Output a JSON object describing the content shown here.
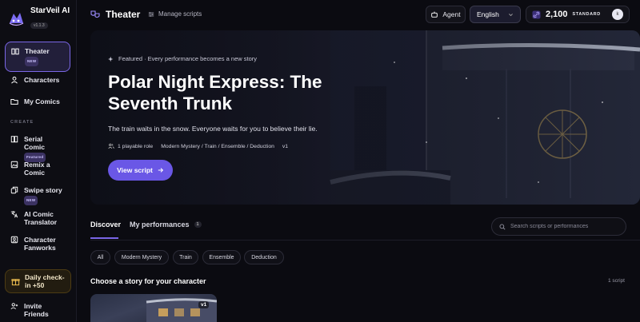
{
  "app": {
    "name": "StarVeil AI",
    "version": "v1.1.3"
  },
  "sidebar": {
    "items": [
      {
        "label": "Theater",
        "badge": "NEW",
        "icon": "book-open-icon"
      },
      {
        "label": "Characters",
        "icon": "user-icon"
      },
      {
        "label": "My Comics",
        "icon": "folder-icon"
      }
    ],
    "create_label": "CREATE",
    "create_items": [
      {
        "label": "Serial Comic",
        "badge": "Featured",
        "icon": "book-icon"
      },
      {
        "label": "Remix a Comic",
        "icon": "image-icon"
      },
      {
        "label": "Swipe story",
        "badge": "NEW",
        "icon": "cards-icon"
      },
      {
        "label": "AI Comic Translator",
        "icon": "translate-icon"
      },
      {
        "label": "Character Fanworks",
        "icon": "portrait-icon"
      }
    ],
    "checkin": "Daily check-in +50",
    "invite": "Invite Friends"
  },
  "header": {
    "title": "Theater",
    "manage": "Manage scripts",
    "agent": "Agent",
    "language": "English",
    "credits": "2,100",
    "plan": "STANDARD",
    "avatar_initial": "k"
  },
  "hero": {
    "featured": "Featured · Every performance becomes a new story",
    "title": "Polar Night Express: The Seventh Trunk",
    "description": "The train waits in the snow. Everyone waits for you to believe their lie.",
    "role": "1 playable role",
    "tags": "Modern Mystery / Train / Ensemble / Deduction",
    "version": "v1",
    "cta": "View script"
  },
  "tabs": {
    "discover": "Discover",
    "performances": "My performances",
    "performances_count": "1"
  },
  "search": {
    "placeholder": "Search scripts or performances"
  },
  "filters": [
    "All",
    "Modern Mystery",
    "Train",
    "Ensemble",
    "Deduction"
  ],
  "list": {
    "heading": "Choose a story for your character",
    "count": "1 script",
    "card_version": "v1"
  },
  "colors": {
    "accent": "#6a57e6",
    "background": "#0b0b11"
  }
}
